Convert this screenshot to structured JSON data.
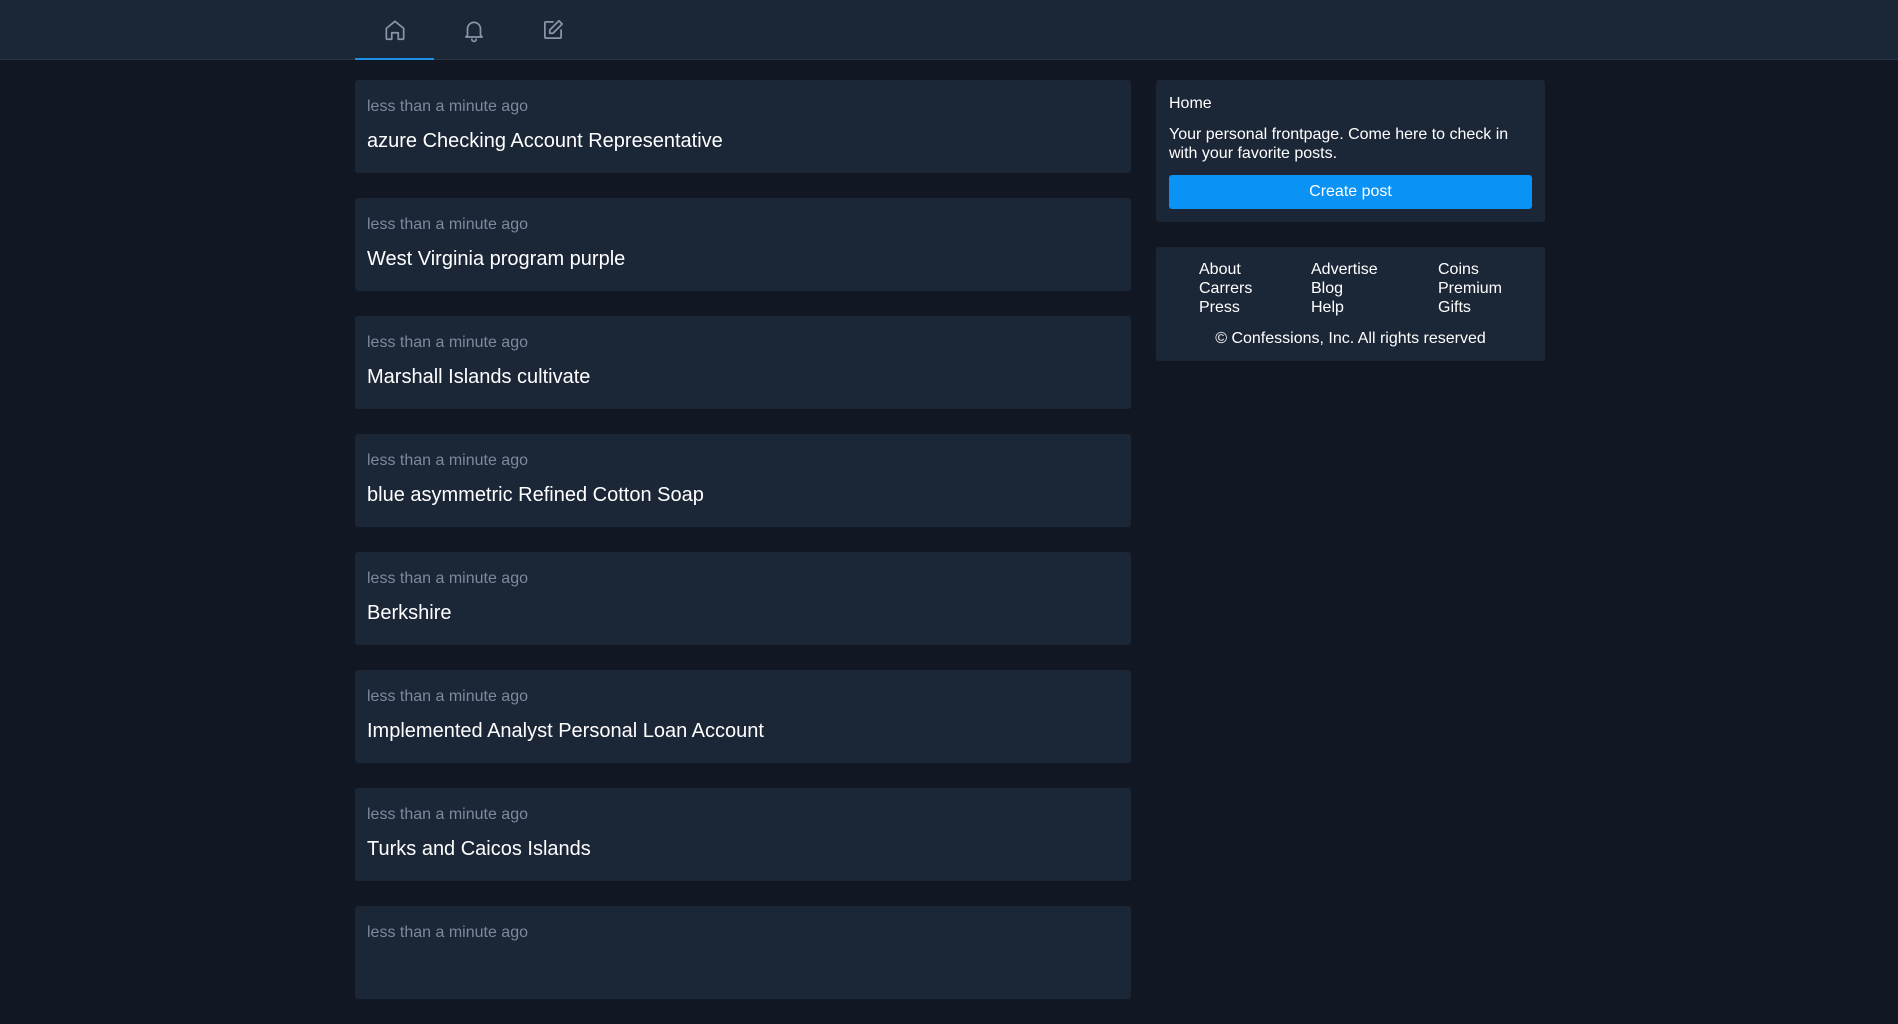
{
  "nav": {
    "tabs": [
      {
        "icon": "home-icon",
        "active": true
      },
      {
        "icon": "bell-icon",
        "active": false
      },
      {
        "icon": "edit-icon",
        "active": false
      }
    ]
  },
  "colors": {
    "background": "#111823",
    "card": "#1b2637",
    "accent": "#0a92f4",
    "muted_text": "#7d8a9c"
  },
  "posts": [
    {
      "time": "less than a minute ago",
      "title": "azure Checking Account Representative"
    },
    {
      "time": "less than a minute ago",
      "title": "West Virginia program purple"
    },
    {
      "time": "less than a minute ago",
      "title": "Marshall Islands cultivate"
    },
    {
      "time": "less than a minute ago",
      "title": "blue asymmetric Refined Cotton Soap"
    },
    {
      "time": "less than a minute ago",
      "title": "Berkshire"
    },
    {
      "time": "less than a minute ago",
      "title": "Implemented Analyst Personal Loan Account"
    },
    {
      "time": "less than a minute ago",
      "title": "Turks and Caicos Islands"
    },
    {
      "time": "less than a minute ago",
      "title": ""
    }
  ],
  "sidebar": {
    "home_title": "Home",
    "home_description": "Your personal frontpage. Come here to check in with your favorite posts.",
    "create_post_label": "Create post",
    "footer_links": [
      [
        "About",
        "Advertise",
        "Coins"
      ],
      [
        "Carrers",
        "Blog",
        "Premium"
      ],
      [
        "Press",
        "Help",
        "Gifts"
      ]
    ],
    "copyright": "© Confessions, Inc. All rights reserved"
  }
}
